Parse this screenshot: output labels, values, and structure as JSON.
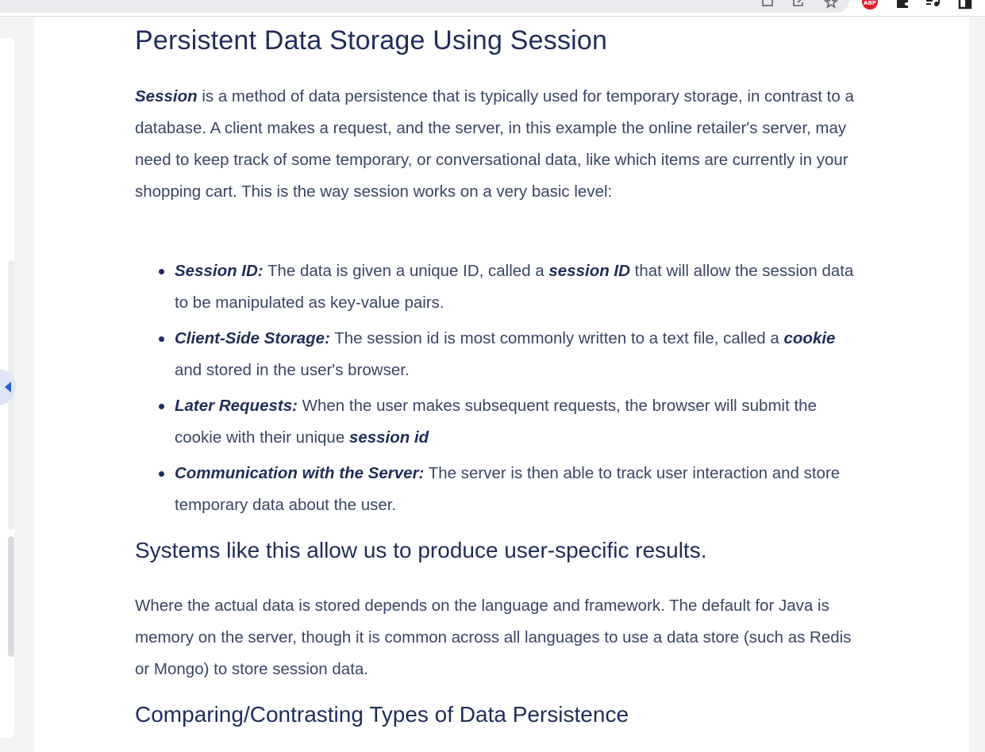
{
  "browser": {
    "extension_badge": "ABP",
    "icons": [
      "screenshot-icon",
      "share-icon",
      "bookmark-star-icon",
      "adblock-icon",
      "extensions-puzzle-icon",
      "media-icon",
      "sidepanel-icon"
    ]
  },
  "article": {
    "title": "Persistent Data Storage Using Session",
    "intro": {
      "lead_bold": "Session",
      "text": " is a method of data persistence that is typically used for temporary storage, in contrast to a database. A client makes a request, and the server, in this example the online retailer's server, may need to keep track of some temporary, or conversational data, like which items are currently in your shopping cart. This is the way session works on a very basic level:"
    },
    "bullets": [
      {
        "term": "Session ID:",
        "text_before": " The data is given a unique ID, called a ",
        "inline_bold": "session ID",
        "text_after": " that will allow the session data to be manipulated as key-value pairs."
      },
      {
        "term": "Client-Side Storage:",
        "text_before": " The session id is most commonly written to a text file, called a ",
        "inline_bold": "cookie",
        "text_after": " and stored in the user's browser."
      },
      {
        "term": "Later Requests:",
        "text_before": " When the user makes subsequent requests, the browser will submit the cookie with their unique ",
        "inline_bold": "session id",
        "text_after": ""
      },
      {
        "term": "Communication with the Server:",
        "text_before": " The server is then able to track user interaction and store temporary data about the user.",
        "inline_bold": "",
        "text_after": ""
      }
    ],
    "subheading_1": "Systems like this allow us to produce user-specific results.",
    "paragraph_2": "Where the actual data is stored depends on the language and framework. The default for Java is memory on the server, though it is common across all languages to use a data store (such as Redis or Mongo) to store session data.",
    "subheading_2": "Comparing/Contrasting Types of Data Persistence"
  },
  "colors": {
    "heading": "#1f2d5a",
    "body_text": "#3a4566",
    "toggle_bg": "#dfe6f7",
    "toggle_arrow": "#2f5fd0"
  }
}
